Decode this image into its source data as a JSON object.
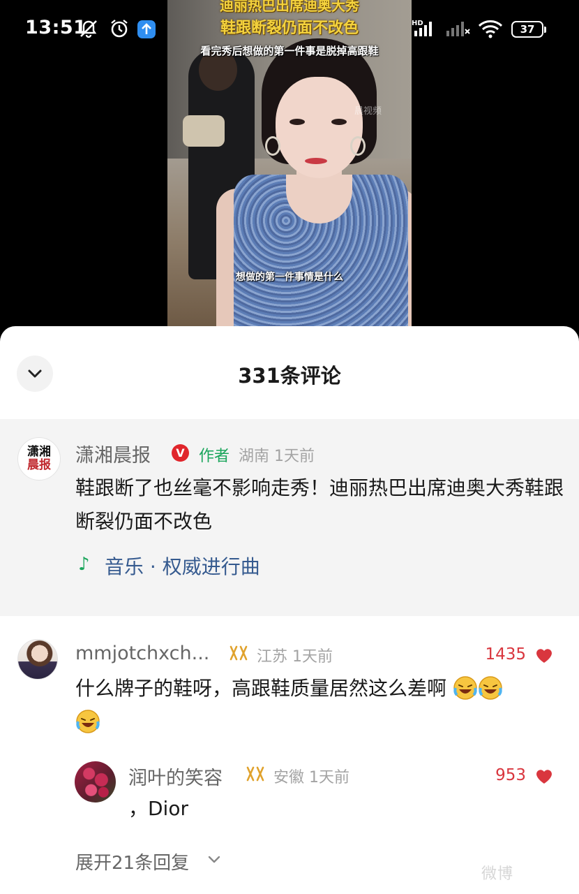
{
  "status_bar": {
    "time": "13:51",
    "battery": "37",
    "network": "HD"
  },
  "video": {
    "title_line1": "迪丽热巴出席迪奥大秀",
    "title_line2": "鞋跟断裂仍面不改色",
    "title_line3": "看完秀后想做的第一件事是脱掉高跟鞋",
    "subtitle": "想做的第一件事情是什么",
    "watermark": "晨视频"
  },
  "comments_panel": {
    "title": "331条评论"
  },
  "author_comment": {
    "avatar_text_top": "潇湘",
    "avatar_text_bottom": "晨报",
    "name": "潇湘晨报",
    "verified_badge": "V",
    "author_tag": "作者",
    "location_time": "湖南 1天前",
    "text": "鞋跟断了也丝毫不影响走秀！迪丽热巴出席迪奥大秀鞋跟断裂仍面不改色",
    "music": "音乐 · 权威进行曲"
  },
  "comments": [
    {
      "name": "mmjotchxch...",
      "location_time": "江苏 1天前",
      "likes": "1435",
      "text": "什么牌子的鞋呀，高跟鞋质量居然这么差啊",
      "emoji": "laughing-crying-emoji"
    },
    {
      "name": "润叶的笑容",
      "location_time": "安徽 1天前",
      "likes": "953",
      "text": "，Dior"
    }
  ],
  "expand_replies": "展开21条回复",
  "watermark_bottom": "微博",
  "colors": {
    "like_red": "#d9363e",
    "author_green": "#1aa55b",
    "music_blue": "#355a8f",
    "level_gold": "#e0a22c"
  }
}
